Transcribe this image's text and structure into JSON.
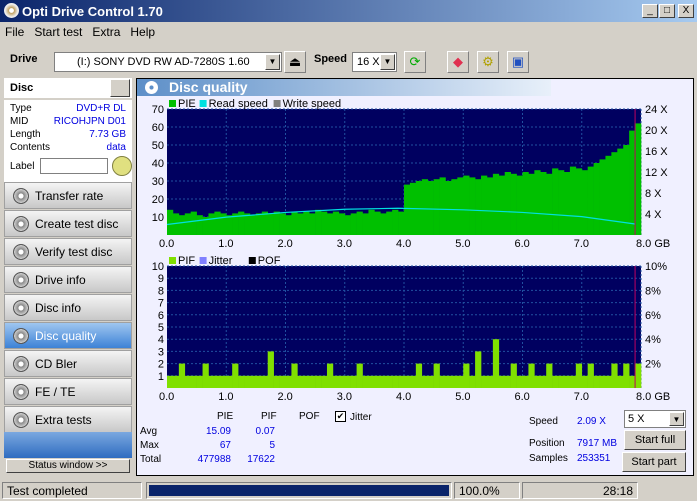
{
  "window": {
    "title": "Opti Drive Control 1.70",
    "min": "_",
    "max": "□",
    "close": "X"
  },
  "menu": [
    "File",
    "Start test",
    "Extra",
    "Help"
  ],
  "toolbar": {
    "drive_label": "Drive",
    "drive_value": "(I:)  SONY DVD RW AD-7280S 1.60",
    "speed_label": "Speed",
    "speed_value": "16 X",
    "icons": [
      "eject-icon",
      "refresh-icon",
      "erase-icon",
      "settings-icon",
      "save-icon"
    ]
  },
  "disc": {
    "header": "Disc",
    "rows": [
      {
        "k": "Type",
        "v": "DVD+R DL"
      },
      {
        "k": "MID",
        "v": "RICOHJPN D01"
      },
      {
        "k": "Length",
        "v": "7.73 GB"
      },
      {
        "k": "Contents",
        "v": "data"
      }
    ],
    "label_label": "Label",
    "label_value": ""
  },
  "sidebar": {
    "items": [
      {
        "label": "Transfer rate"
      },
      {
        "label": "Create test disc"
      },
      {
        "label": "Verify test disc"
      },
      {
        "label": "Drive info"
      },
      {
        "label": "Disc info"
      },
      {
        "label": "Disc quality",
        "active": true
      },
      {
        "label": "CD Bler"
      },
      {
        "label": "FE / TE"
      },
      {
        "label": "Extra tests"
      }
    ],
    "status_window": "Status window >>"
  },
  "panel": {
    "title": "Disc quality"
  },
  "colors": {
    "pie": "#00c000",
    "read": "#00e0e0",
    "write": "#808080",
    "pif": "#80e000",
    "jitter": "#8080ff",
    "pof": "#000000",
    "plot_bg": "#000060",
    "grid": "#2050a0"
  },
  "chart_data": [
    {
      "type": "bar",
      "legend": [
        "PIE",
        "Read speed",
        "Write speed"
      ],
      "legend_placement": "top-left",
      "xlim": [
        0,
        8.0
      ],
      "xunit": "GB",
      "xticks": [
        "0.0",
        "1.0",
        "2.0",
        "3.0",
        "4.0",
        "5.0",
        "6.0",
        "7.0",
        "8.0 GB"
      ],
      "ylim": [
        0,
        70
      ],
      "yticks": [
        "10",
        "20",
        "30",
        "40",
        "50",
        "60",
        "70"
      ],
      "y2lim": [
        0,
        24
      ],
      "y2ticks": [
        "4 X",
        "8 X",
        "12 X",
        "16 X",
        "20 X",
        "24 X"
      ],
      "grid": true,
      "x_step": 0.1,
      "pie": [
        14,
        12,
        11,
        12,
        13,
        11,
        10,
        12,
        13,
        12,
        11,
        12,
        13,
        12,
        11,
        12,
        13,
        12,
        13,
        12,
        11,
        13,
        12,
        13,
        12,
        14,
        13,
        12,
        13,
        12,
        11,
        12,
        13,
        12,
        14,
        13,
        12,
        13,
        14,
        13,
        28,
        29,
        30,
        31,
        30,
        31,
        32,
        30,
        31,
        32,
        33,
        32,
        31,
        33,
        32,
        34,
        33,
        35,
        34,
        33,
        35,
        34,
        36,
        35,
        34,
        37,
        36,
        35,
        38,
        37,
        36,
        38,
        40,
        42,
        44,
        46,
        48,
        50,
        58,
        62
      ],
      "read_speed_x": [
        [
          0,
          2.0
        ],
        [
          1.0,
          3.4
        ],
        [
          2.0,
          4.3
        ],
        [
          3.0,
          4.9
        ],
        [
          3.9,
          5.1
        ],
        [
          5.0,
          4.8
        ],
        [
          6.0,
          4.3
        ],
        [
          7.0,
          3.5
        ],
        [
          7.9,
          2.1
        ]
      ]
    },
    {
      "type": "bar",
      "legend": [
        "PIF",
        "Jitter",
        "POF"
      ],
      "legend_placement": "top-left",
      "xlim": [
        0,
        8.0
      ],
      "xunit": "GB",
      "xticks": [
        "0.0",
        "1.0",
        "2.0",
        "3.0",
        "4.0",
        "5.0",
        "6.0",
        "7.0",
        "8.0 GB"
      ],
      "ylim": [
        0,
        10
      ],
      "yticks": [
        "1",
        "2",
        "3",
        "4",
        "5",
        "6",
        "7",
        "8",
        "9",
        "10"
      ],
      "y2ticks": [
        "2%",
        "4%",
        "6%",
        "8%",
        "10%"
      ],
      "grid": true,
      "x_step": 0.1,
      "pif": [
        1,
        1,
        2,
        1,
        1,
        1,
        2,
        1,
        1,
        1,
        1,
        2,
        1,
        1,
        1,
        1,
        1,
        3,
        1,
        1,
        1,
        2,
        1,
        1,
        1,
        1,
        1,
        2,
        1,
        1,
        1,
        1,
        2,
        1,
        1,
        1,
        1,
        1,
        1,
        1,
        1,
        1,
        2,
        1,
        1,
        2,
        1,
        1,
        1,
        1,
        2,
        1,
        3,
        1,
        1,
        4,
        1,
        1,
        2,
        1,
        1,
        2,
        1,
        1,
        2,
        1,
        1,
        1,
        1,
        2,
        1,
        2,
        1,
        1,
        1,
        2,
        1,
        2,
        1,
        2
      ]
    }
  ],
  "stats": {
    "headers": [
      "PIE",
      "PIF",
      "POF"
    ],
    "jitter_label": "Jitter",
    "jitter_checked": true,
    "rows": [
      {
        "k": "Avg",
        "pie": "15.09",
        "pif": "0.07"
      },
      {
        "k": "Max",
        "pie": "67",
        "pif": "5"
      },
      {
        "k": "Total",
        "pie": "477988",
        "pif": "17622"
      }
    ]
  },
  "run": {
    "speed_label": "Speed",
    "speed_value": "2.09 X",
    "speed_select": "5 X",
    "position_label": "Position",
    "position_value": "7917 MB",
    "samples_label": "Samples",
    "samples_value": "253351",
    "start_full": "Start full",
    "start_part": "Start part"
  },
  "statusbar": {
    "text": "Test completed",
    "progress": 100,
    "progress_text": "100.0%",
    "time": "28:18"
  }
}
